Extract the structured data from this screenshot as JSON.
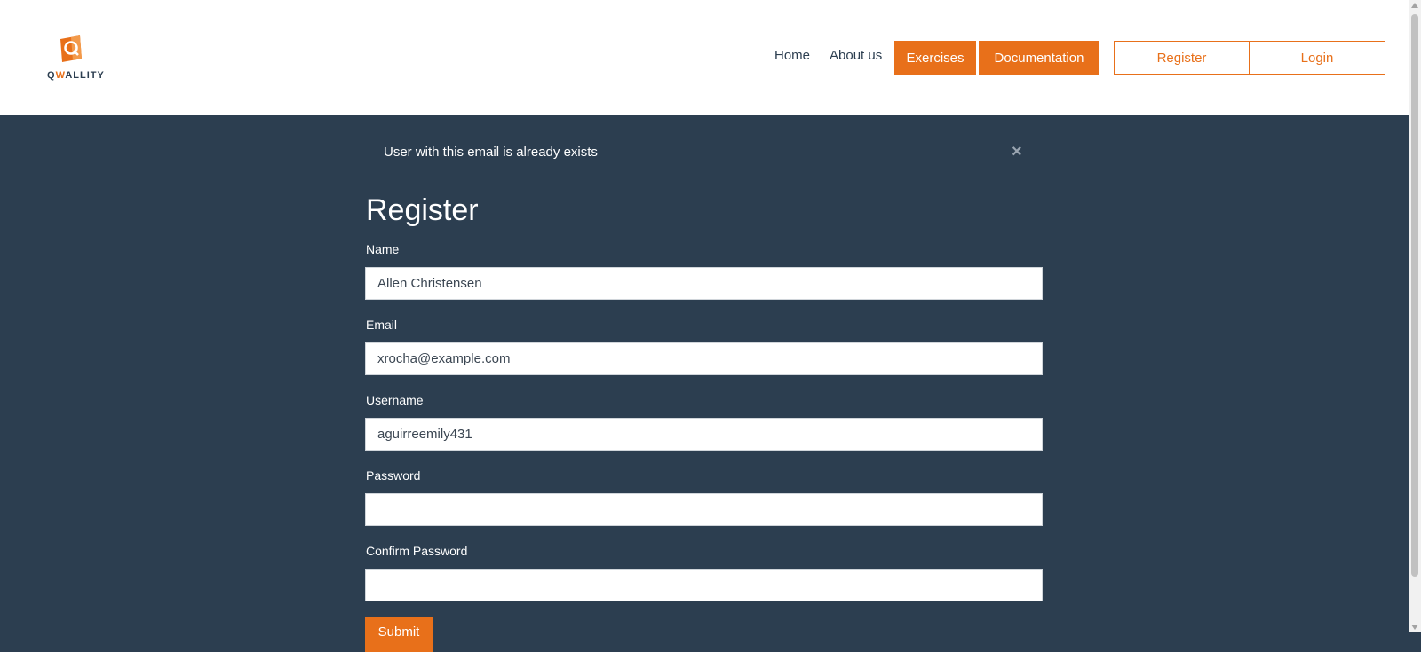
{
  "brand": {
    "logo_text_q": "Q",
    "logo_text_w": "W",
    "logo_text_rest": "ALLITY",
    "accent_color": "#e8701a",
    "background_color": "#2c3e50"
  },
  "nav": {
    "home": "Home",
    "about": "About us",
    "exercises": "Exercises",
    "documentation": "Documentation",
    "register": "Register",
    "login": "Login"
  },
  "alert": {
    "message": "User with this email is already exists",
    "close_symbol": "×"
  },
  "form": {
    "title": "Register",
    "name_label": "Name",
    "name_value": "Allen Christensen",
    "email_label": "Email",
    "email_value": "xrocha@example.com",
    "username_label": "Username",
    "username_value": "aguirreemily431",
    "password_label": "Password",
    "password_value": "",
    "confirm_label": "Confirm Password",
    "confirm_value": "",
    "submit_label": "Submit"
  }
}
